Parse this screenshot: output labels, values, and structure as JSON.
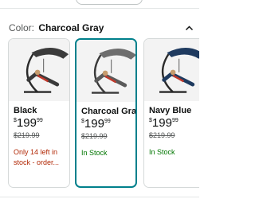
{
  "color_selector": {
    "label": "Color:",
    "selected_value": "Charcoal Gray"
  },
  "icons": {
    "chevron": "chevron-up-icon"
  },
  "colors": {
    "accent_selected_border": "#00808c",
    "in_stock": "#007600",
    "low_stock": "#b12704"
  },
  "options": [
    {
      "name": "Black",
      "currency": "$",
      "price_dollars": "199",
      "price_cents": "99",
      "list_price": "$219.99",
      "availability": "Only 14 left in stock - order...",
      "canopy_color": "#3b3b3b",
      "selected": false
    },
    {
      "name": "Charcoal Gray",
      "currency": "$",
      "price_dollars": "199",
      "price_cents": "99",
      "list_price": "$219.99",
      "availability": "In Stock",
      "canopy_color": "#6e6e6e",
      "selected": true
    },
    {
      "name": "Navy Blue",
      "currency": "$",
      "price_dollars": "199",
      "price_cents": "99",
      "list_price": "$219.99",
      "availability": "In Stock",
      "canopy_color": "#1e3a5f",
      "selected": false
    }
  ]
}
